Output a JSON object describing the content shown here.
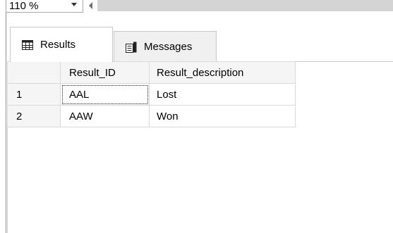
{
  "zoom": {
    "value": "110 %",
    "dropdown_icon": "chevron-down-icon",
    "scroll_left_icon": "arrow-left-icon"
  },
  "tabs": [
    {
      "label": "Results",
      "icon": "grid-icon",
      "active": true
    },
    {
      "label": "Messages",
      "icon": "messages-icon",
      "active": false
    }
  ],
  "grid": {
    "columns": [
      "Result_ID",
      "Result_description"
    ],
    "rows": [
      {
        "num": "1",
        "cells": [
          "AAL",
          "Lost"
        ]
      },
      {
        "num": "2",
        "cells": [
          "AAW",
          "Won"
        ]
      }
    ],
    "focused_cell": "AAL"
  },
  "colors": {
    "header_bg": "#f5f5f5",
    "grid_border": "#d9d9d9",
    "scroll_track": "#d4d4d4"
  }
}
